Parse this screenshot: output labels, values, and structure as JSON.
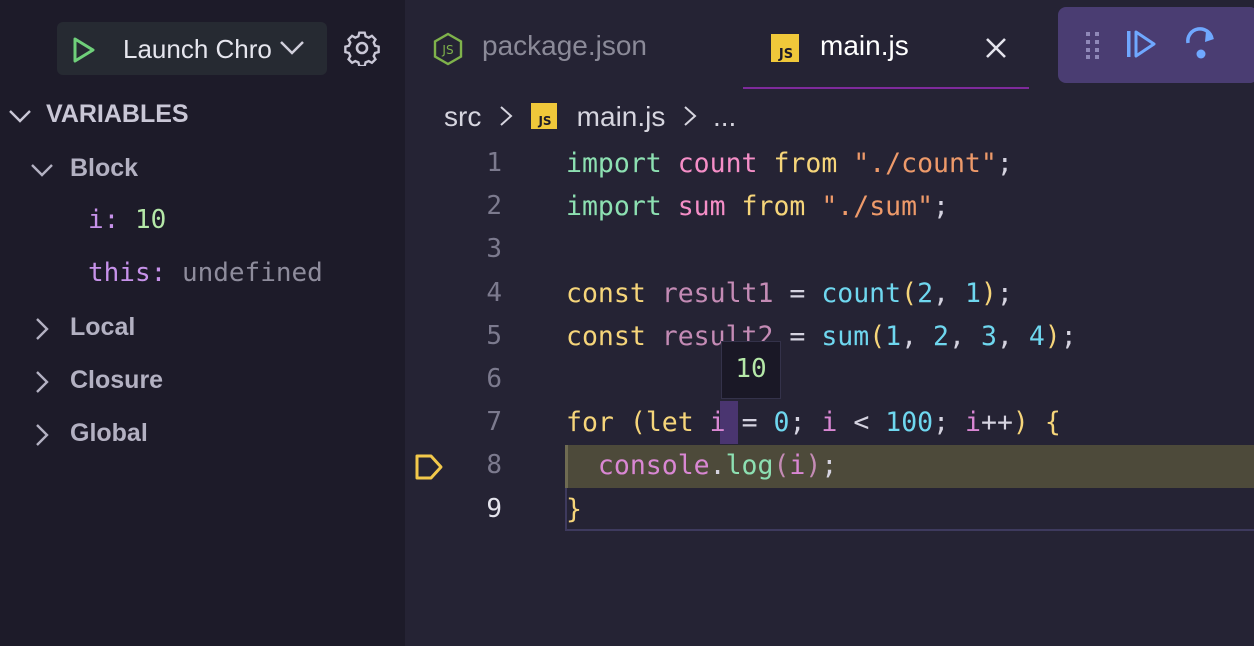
{
  "sidebar": {
    "launch_label": "Launch Chrome",
    "section_title": "VARIABLES",
    "scopes": [
      {
        "label": "Block",
        "expanded": true
      },
      {
        "label": "Local",
        "expanded": false
      },
      {
        "label": "Closure",
        "expanded": false
      },
      {
        "label": "Global",
        "expanded": false
      }
    ],
    "block_vars": [
      {
        "name": "i:",
        "value": "10"
      },
      {
        "name": "this:",
        "value": "undefined"
      }
    ]
  },
  "tabs": [
    {
      "label": "package.json",
      "icon": "nodejs-icon",
      "active": false
    },
    {
      "label": "main.js",
      "icon": "js-icon",
      "active": true
    }
  ],
  "breadcrumb": {
    "folder": "src",
    "file": "main.js",
    "more": "..."
  },
  "editor": {
    "line_numbers": [
      "1",
      "2",
      "3",
      "4",
      "5",
      "6",
      "7",
      "8",
      "9"
    ],
    "current_line": 8,
    "hover_value": "10"
  },
  "colors": {
    "accent": "#7e2a9b",
    "debug_toolbar": "#4a3d72",
    "breakpoint": "#f2c84b"
  }
}
